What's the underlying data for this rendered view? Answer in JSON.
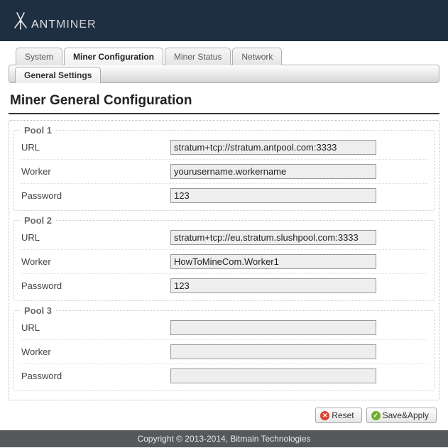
{
  "brand": {
    "name_strong": "ANT",
    "name_light": "MINER"
  },
  "tabs": {
    "system": "System",
    "miner_config": "Miner Configuration",
    "miner_status": "Miner Status",
    "network": "Network"
  },
  "subtab": {
    "general": "General Settings"
  },
  "page_title": "Miner General Configuration",
  "pools": [
    {
      "legend": "Pool 1",
      "url_label": "URL",
      "url_value": "stratum+tcp://stratum.antpool.com:3333",
      "worker_label": "Worker",
      "worker_value": "yourusername.workername",
      "password_label": "Password",
      "password_value": "123"
    },
    {
      "legend": "Pool 2",
      "url_label": "URL",
      "url_value": "stratum+tcp://eu.stratum.slushpool.com:3333",
      "worker_label": "Worker",
      "worker_value": "HowToMineCom.Worker1",
      "password_label": "Password",
      "password_value": "123"
    },
    {
      "legend": "Pool 3",
      "url_label": "URL",
      "url_value": "",
      "worker_label": "Worker",
      "worker_value": "",
      "password_label": "Password",
      "password_value": ""
    }
  ],
  "buttons": {
    "reset": "Reset",
    "save_apply": "Save&Apply"
  },
  "footer": "Copyright © 2013-2014, Bitmain Technologies"
}
